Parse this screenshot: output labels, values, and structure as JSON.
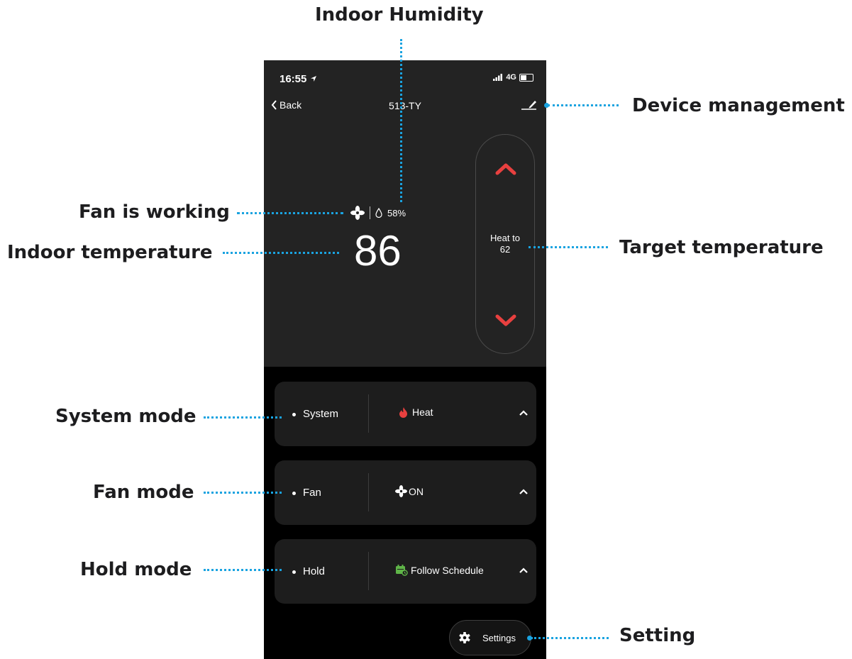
{
  "annotations": {
    "indoor_humidity": "Indoor Humidity",
    "device_management": "Device management",
    "fan_working": "Fan is working",
    "indoor_temperature": "Indoor temperature",
    "target_temperature": "Target temperature",
    "system_mode": "System mode",
    "fan_mode": "Fan mode",
    "hold_mode": "Hold mode",
    "setting": "Setting"
  },
  "status_bar": {
    "time": "16:55",
    "network": "4G"
  },
  "header": {
    "back_label": "Back",
    "title": "513-TY"
  },
  "readings": {
    "humidity": "58%",
    "temperature": "86"
  },
  "setpoint": {
    "line1": "Heat to",
    "line2": "62"
  },
  "modes": [
    {
      "label": "System",
      "value": "Heat",
      "icon": "flame-icon"
    },
    {
      "label": "Fan",
      "value": "ON",
      "icon": "fan-icon"
    },
    {
      "label": "Hold",
      "value": "Follow Schedule",
      "icon": "calendar-icon"
    }
  ],
  "settings": {
    "label": "Settings"
  },
  "colors": {
    "accent_red": "#e8403f",
    "annotation_line": "#1aa3e0",
    "schedule_green": "#5fb548"
  }
}
